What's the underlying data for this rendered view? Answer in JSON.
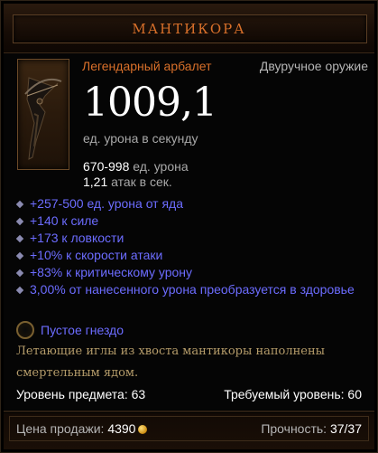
{
  "header": {
    "title": "МАНТИКОРА"
  },
  "item": {
    "type": "Легендарный арбалет",
    "slot": "Двуручное оружие",
    "dps_value": "1009,1",
    "dps_label": "ед. урона в секунду",
    "damage_range": "670-998",
    "damage_unit": "ед. урона",
    "attack_speed": "1,21",
    "attack_speed_unit": "атак в сек."
  },
  "affixes": [
    "+257-500 ед. урона от яда",
    "+140 к силе",
    "+173 к ловкости",
    "+10% к скорости атаки",
    "+83% к критическому урону",
    "3,00% от нанесенного урона преобразуется в здоровье"
  ],
  "socket": {
    "label": "Пустое гнездо"
  },
  "flavor": "Летающие иглы из хвоста мантикоры наполнены смертельным ядом.",
  "requirements": {
    "item_level": "Уровень предмета: 63",
    "required_level": "Требуемый уровень: 60"
  },
  "footer": {
    "sell_label": "Цена продажи:",
    "sell_value": "4390",
    "durability_label": "Прочность:",
    "durability_value": "37/37"
  },
  "colors": {
    "legendary": "#d9702a",
    "magic": "#6c6cff",
    "flavor": "#b59c6a"
  }
}
